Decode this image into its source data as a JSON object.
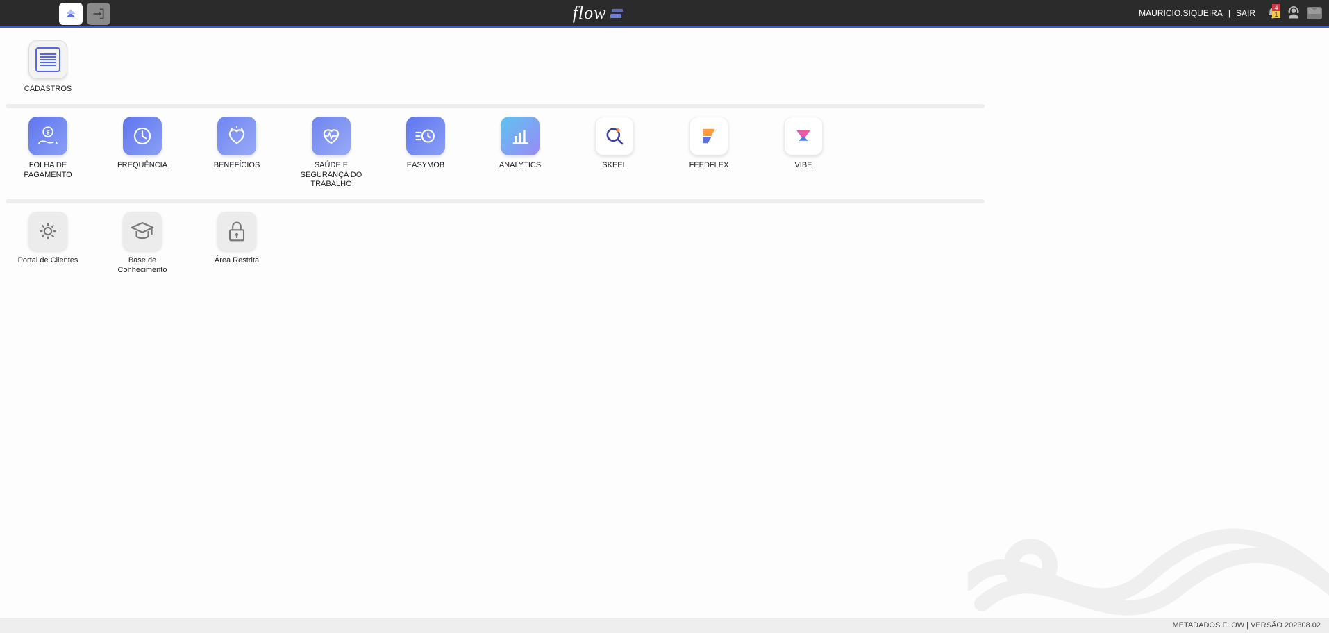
{
  "header": {
    "brand": "flow",
    "user": "MAURICIO.SIQUEIRA",
    "logout": "SAIR",
    "notif_red": "4",
    "notif_yellow": "1"
  },
  "section1": {
    "items": [
      {
        "id": "cadastros",
        "label": "CADASTROS"
      }
    ]
  },
  "section2": {
    "items": [
      {
        "id": "folha",
        "label": "FOLHA DE PAGAMENTO"
      },
      {
        "id": "frequencia",
        "label": "FREQUÊNCIA"
      },
      {
        "id": "beneficios",
        "label": "BENEFÍCIOS"
      },
      {
        "id": "sst",
        "label": "SAÚDE E SEGURANÇA DO TRABALHO"
      },
      {
        "id": "easymob",
        "label": "EASYMOB"
      },
      {
        "id": "analytics",
        "label": "ANALYTICS"
      },
      {
        "id": "skeel",
        "label": "SKEEL"
      },
      {
        "id": "feedflex",
        "label": "FEEDFLEX"
      },
      {
        "id": "vibe",
        "label": "VIBE"
      }
    ]
  },
  "section3": {
    "items": [
      {
        "id": "portal",
        "label": "Portal de Clientes"
      },
      {
        "id": "basekb",
        "label": "Base de Conhecimento"
      },
      {
        "id": "restrita",
        "label": "Área Restrita"
      }
    ]
  },
  "footer": {
    "text": "METADADOS FLOW | VERSÃO 202308.02"
  }
}
